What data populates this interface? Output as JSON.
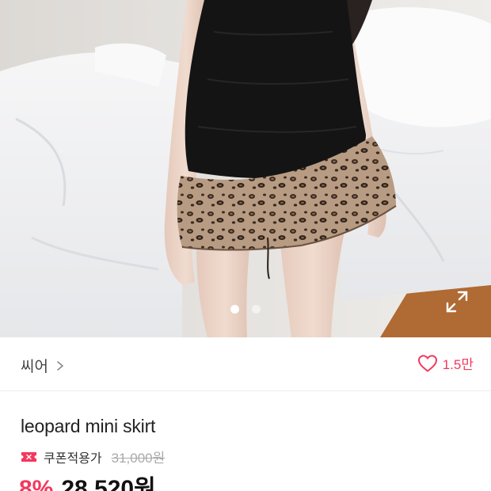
{
  "hero": {
    "image_description_icon": "product-photo",
    "carousel_dots": 2,
    "active_dot": 0
  },
  "brand": {
    "name": "씨어",
    "chevron_icon": "chevron-right-icon"
  },
  "like": {
    "icon": "heart-outline-icon",
    "count": "1.5만",
    "color": "#f4385e"
  },
  "product": {
    "title": "leopard mini skirt",
    "coupon_icon": "coupon-icon",
    "coupon_label": "쿠폰적용가",
    "original_price": "31,000원",
    "discount": "8%",
    "price": "28,520원"
  },
  "colors": {
    "accent": "#f4385e"
  }
}
